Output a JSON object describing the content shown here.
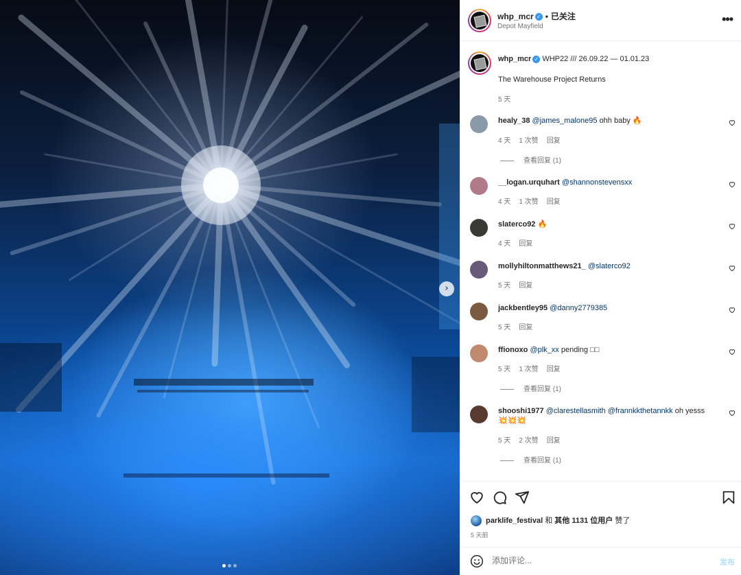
{
  "header": {
    "username": "whp_mcr",
    "verified_badge": "✓",
    "separator": "•",
    "follow_status": "已关注",
    "location": "Depot Mayfield",
    "more_icon": "•••"
  },
  "caption": {
    "username": "whp_mcr",
    "text1": "WHP22 /// 26.09.22 — 01.01.23",
    "text2": "The Warehouse Project Returns",
    "time": "5 天"
  },
  "comments": [
    {
      "username": "healy_38",
      "mention": "@james_malone95",
      "text": "ohh baby",
      "emoji": "🔥",
      "time": "4 天",
      "likes": "1 次赞",
      "reply": "回复",
      "view_replies": "查看回复 (1)",
      "avatar_color": "#8b9aa8"
    },
    {
      "username": "__logan.urquhart",
      "mention": "@shannonstevensxx",
      "text": "",
      "emoji": "",
      "time": "4 天",
      "likes": "1 次赞",
      "reply": "回复",
      "view_replies": "",
      "avatar_color": "#b07a88"
    },
    {
      "username": "slaterco92",
      "mention": "",
      "text": "",
      "emoji": "🔥",
      "time": "4 天",
      "likes": "",
      "reply": "回复",
      "view_replies": "",
      "avatar_color": "#3a3a34"
    },
    {
      "username": "mollyhiltonmatthews21_",
      "mention": "@slaterco92",
      "text": "",
      "emoji": "",
      "time": "5 天",
      "likes": "",
      "reply": "回复",
      "view_replies": "",
      "avatar_color": "#6a5a7a"
    },
    {
      "username": "jackbentley95",
      "mention": "@danny2779385",
      "text": "",
      "emoji": "",
      "time": "5 天",
      "likes": "",
      "reply": "回复",
      "view_replies": "",
      "avatar_color": "#7a5a40"
    },
    {
      "username": "ffionoxo",
      "mention": "@plk_xx",
      "text": "pending □□",
      "emoji": "",
      "time": "5 天",
      "likes": "1 次赞",
      "reply": "回复",
      "view_replies": "查看回复 (1)",
      "avatar_color": "#c08a70"
    },
    {
      "username": "shooshi1977",
      "mention": "@clarestellasmith",
      "mention2": "@frannkkthetannkk",
      "text": "oh yesss",
      "emoji_line": "💥💥💥",
      "time": "5 天",
      "likes": "2 次赞",
      "reply": "回复",
      "view_replies": "查看回复 (1)",
      "avatar_color": "#5a3a30"
    }
  ],
  "actions": {
    "like_icon": "heart-icon",
    "comment_icon": "comment-icon",
    "share_icon": "paper-plane-icon",
    "save_icon": "bookmark-icon"
  },
  "likes": {
    "user": "parklife_festival",
    "conj": "和",
    "others": "其他 1131 位用户",
    "suffix": "赞了"
  },
  "post_time": "5 天前",
  "add_comment": {
    "placeholder": "添加评论...",
    "post_label": "发布"
  },
  "carousel": {
    "next_icon": "›",
    "dot_count": 3,
    "active_dot": 0
  },
  "colors": {
    "mention": "#00376b",
    "verified": "#3897f0",
    "post_button": "#b2dffc"
  }
}
